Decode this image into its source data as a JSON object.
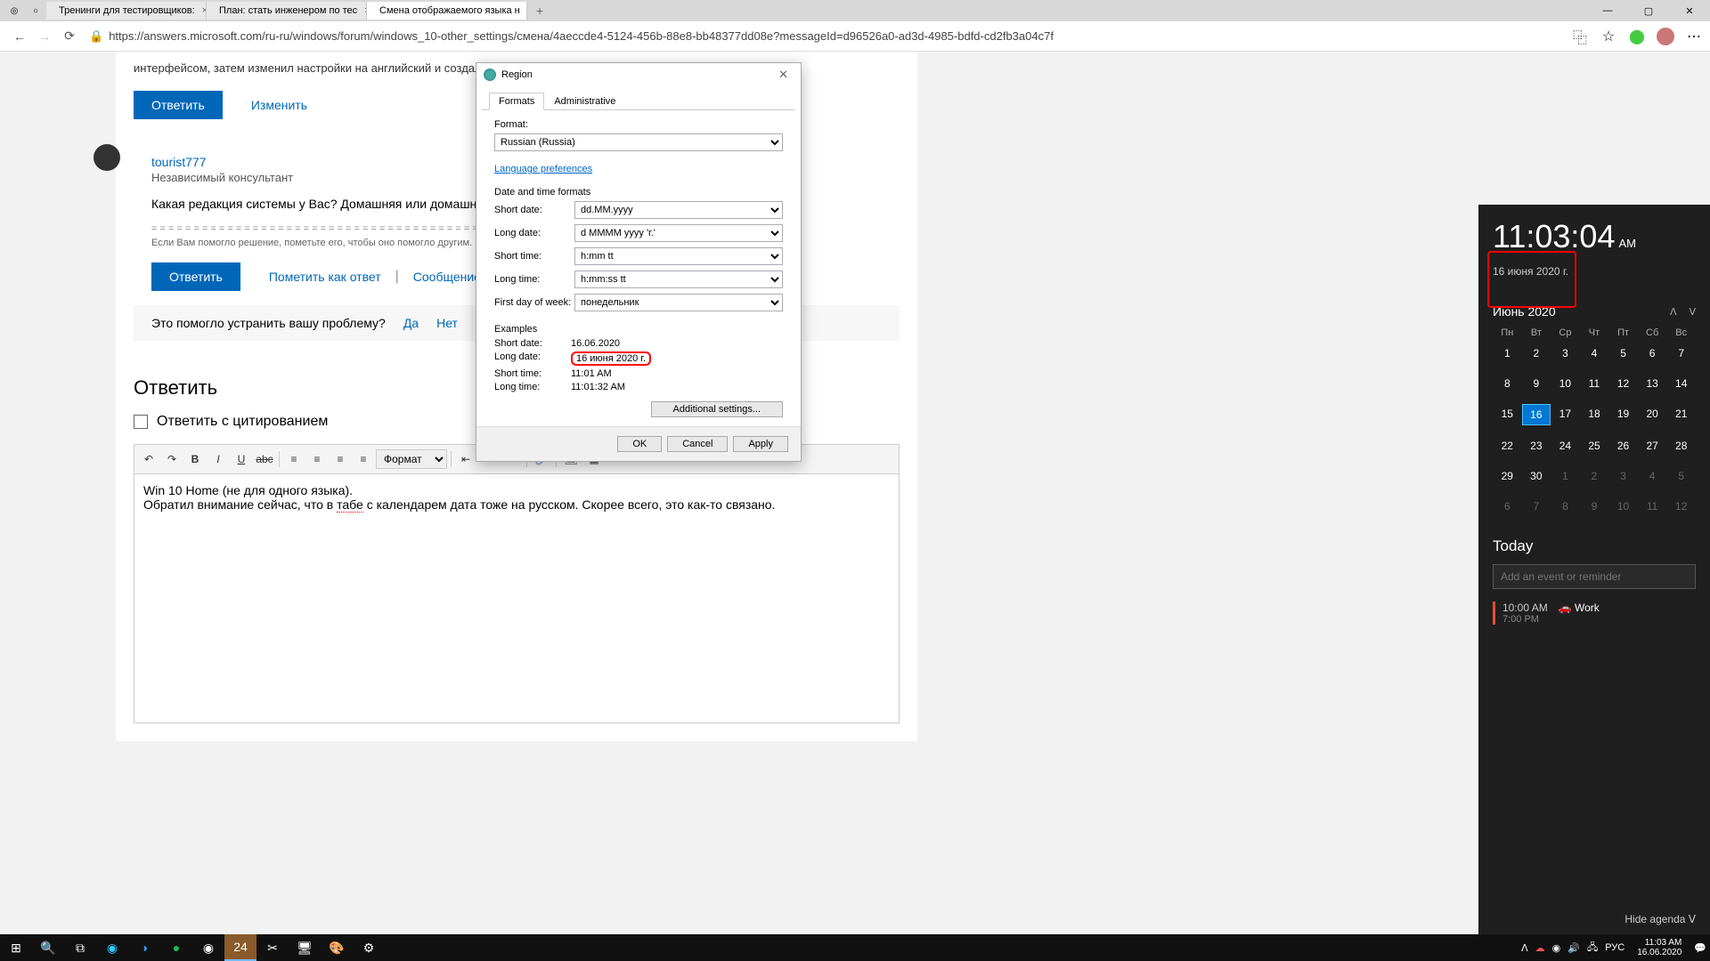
{
  "browser": {
    "tabs": [
      {
        "label": "Тренинги для тестировщиков:"
      },
      {
        "label": "План: стать инженером по тес"
      },
      {
        "label": "Смена отображаемого языка н",
        "active": true
      }
    ],
    "url": "https://answers.microsoft.com/ru-ru/windows/forum/windows_10-other_settings/смена/4aeccde4-5124-456b-88e8-bb48377dd08e?messageId=d96526a0-ad3d-4985-bdfd-cd2fb3a04c7f"
  },
  "page": {
    "snippet": "интерфейсом, затем изменил настройки на английский и создал еще раз, но приветственный экран остается неизменен.",
    "reply_label": "Ответить",
    "edit_label": "Изменить",
    "answer": {
      "user": "tourist777",
      "role": "Независимый консультант",
      "text": "Какая редакция системы у Вас? Домашняя или домашняя для одного язы",
      "footer": "Если Вам помогло решение, пометьте его, чтобы оно помогло другим.",
      "mark_answer": "Пометить как ответ",
      "report": "Сообщение о нарушении"
    },
    "helpful": {
      "q": "Это помогло устранить вашу проблему?",
      "yes": "Да",
      "no": "Нет"
    },
    "reply_header": "Ответить",
    "quote_label": "Ответить с цитированием",
    "format_placeholder": "Формат",
    "editor_line1": "Win 10 Home (не для одного языка).",
    "editor_line2a": "Обратил внимание сейчас, что в ",
    "editor_line2_word": "табе",
    "editor_line2b": " с календарем дата тоже на русском. Скорее всего, это как-то связано."
  },
  "region": {
    "title": "Region",
    "tab_formats": "Formats",
    "tab_admin": "Administrative",
    "format_label": "Format:",
    "format_value": "Russian (Russia)",
    "lang_prefs": "Language preferences",
    "group_dt": "Date and time formats",
    "short_date_l": "Short date:",
    "short_date_v": "dd.MM.yyyy",
    "long_date_l": "Long date:",
    "long_date_v": "d MMMM yyyy 'г.'",
    "short_time_l": "Short time:",
    "short_time_v": "h:mm tt",
    "long_time_l": "Long time:",
    "long_time_v": "h:mm:ss tt",
    "first_day_l": "First day of week:",
    "first_day_v": "понедельник",
    "examples_label": "Examples",
    "ex_short_date": "16.06.2020",
    "ex_long_date": "16 июня 2020 г.",
    "ex_short_time": "11:01 AM",
    "ex_long_time": "11:01:32 AM",
    "add_settings": "Additional settings...",
    "ok": "OK",
    "cancel": "Cancel",
    "apply": "Apply"
  },
  "calendar": {
    "time": "11:03:04",
    "ampm": "AM",
    "date": "16 июня 2020 г.",
    "month": "Июнь 2020",
    "dow": [
      "Пн",
      "Вт",
      "Ср",
      "Чт",
      "Пт",
      "Сб",
      "Вс"
    ],
    "weeks": [
      [
        {
          "n": "1"
        },
        {
          "n": "2"
        },
        {
          "n": "3"
        },
        {
          "n": "4"
        },
        {
          "n": "5"
        },
        {
          "n": "6"
        },
        {
          "n": "7"
        }
      ],
      [
        {
          "n": "8"
        },
        {
          "n": "9"
        },
        {
          "n": "10"
        },
        {
          "n": "11"
        },
        {
          "n": "12"
        },
        {
          "n": "13"
        },
        {
          "n": "14"
        }
      ],
      [
        {
          "n": "15"
        },
        {
          "n": "16",
          "today": true
        },
        {
          "n": "17"
        },
        {
          "n": "18"
        },
        {
          "n": "19"
        },
        {
          "n": "20"
        },
        {
          "n": "21"
        }
      ],
      [
        {
          "n": "22"
        },
        {
          "n": "23"
        },
        {
          "n": "24"
        },
        {
          "n": "25"
        },
        {
          "n": "26"
        },
        {
          "n": "27"
        },
        {
          "n": "28"
        }
      ],
      [
        {
          "n": "29"
        },
        {
          "n": "30"
        },
        {
          "n": "1",
          "dim": true
        },
        {
          "n": "2",
          "dim": true
        },
        {
          "n": "3",
          "dim": true
        },
        {
          "n": "4",
          "dim": true
        },
        {
          "n": "5",
          "dim": true
        }
      ],
      [
        {
          "n": "6",
          "dim": true
        },
        {
          "n": "7",
          "dim": true
        },
        {
          "n": "8",
          "dim": true
        },
        {
          "n": "9",
          "dim": true
        },
        {
          "n": "10",
          "dim": true
        },
        {
          "n": "11",
          "dim": true
        },
        {
          "n": "12",
          "dim": true
        }
      ]
    ],
    "today_label": "Today",
    "event_placeholder": "Add an event or reminder",
    "event": {
      "time": "10:00 AM",
      "end": "7:00 PM",
      "title": "Work"
    },
    "hide_agenda": "Hide agenda"
  },
  "tray": {
    "lang": "РУС",
    "time": "11:03 AM",
    "date": "16.06.2020"
  }
}
